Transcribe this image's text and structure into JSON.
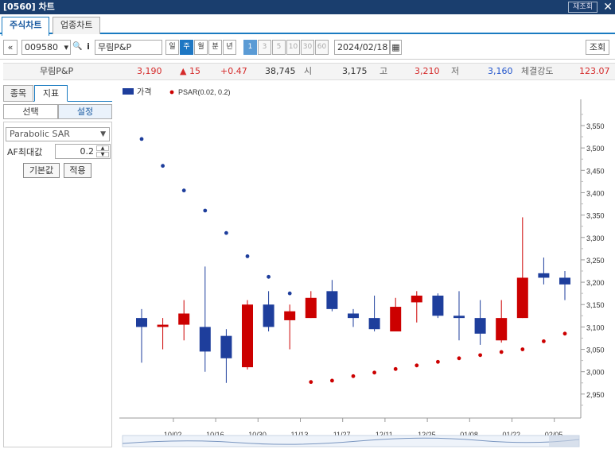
{
  "window": {
    "title": "[0560] 차트",
    "refresh": "재조회",
    "close": "✕"
  },
  "tabs": [
    {
      "label": "주식차트"
    },
    {
      "label": "업종차트"
    }
  ],
  "toolbar": {
    "nav": "«",
    "code": "009580",
    "dropdown": "▾",
    "search": "🔍",
    "info": "i",
    "name": "무림P&P",
    "periods": [
      "일",
      "주",
      "월",
      "분",
      "년"
    ],
    "nums": [
      "1",
      "3",
      "5",
      "10",
      "30",
      "60"
    ],
    "date": "2024/02/18",
    "calendar": "▦",
    "query": "조회"
  },
  "quote": {
    "name": "무림P&P",
    "price": "3,190",
    "change": "▲ 15",
    "rate": "+0.47",
    "volume": "38,745",
    "open_l": "시",
    "open": "3,175",
    "high_l": "고",
    "high": "3,210",
    "low_l": "저",
    "low": "3,160",
    "str_l": "체결강도",
    "str": "123.07"
  },
  "left": {
    "tab1": "종목",
    "tab2": "지표",
    "sub1": "선택",
    "sub2": "설정",
    "indicator": "Parabolic SAR",
    "af_label": "AF최대값",
    "af_value": "0.2",
    "btn_default": "기본값",
    "btn_apply": "적용"
  },
  "colors": {
    "up": "#cc0000",
    "down": "#1e3e9c",
    "accent": "#1a7bc1"
  },
  "chart_data": {
    "type": "candlestick",
    "legend": [
      {
        "name": "가격"
      },
      {
        "name": "PSAR(0.02, 0.2)"
      }
    ],
    "ylim": [
      2900,
      3600
    ],
    "yticks": [
      "3,550",
      "3,500",
      "3,450",
      "3,400",
      "3,350",
      "3,300",
      "3,250",
      "3,200",
      "3,150",
      "3,100",
      "3,050",
      "3,000",
      "2,950"
    ],
    "ytickvals": [
      3550,
      3500,
      3450,
      3400,
      3350,
      3300,
      3250,
      3200,
      3150,
      3100,
      3050,
      3000,
      2950
    ],
    "xticks": [
      "10/02",
      "10/16",
      "10/30",
      "11/13",
      "11/27",
      "12/11",
      "12/25",
      "01/08",
      "01/22",
      "02/05"
    ],
    "xtickidx": [
      1.5,
      3.5,
      5.5,
      7.5,
      9.5,
      11.5,
      13.5,
      15.5,
      17.5,
      19.5
    ],
    "candles": [
      {
        "o": 3120,
        "h": 3140,
        "l": 3020,
        "c": 3100
      },
      {
        "o": 3100,
        "h": 3120,
        "l": 3050,
        "c": 3105
      },
      {
        "o": 3105,
        "h": 3160,
        "l": 3070,
        "c": 3130
      },
      {
        "o": 3100,
        "h": 3235,
        "l": 3000,
        "c": 3045
      },
      {
        "o": 3080,
        "h": 3095,
        "l": 2975,
        "c": 3030
      },
      {
        "o": 3010,
        "h": 3160,
        "l": 3005,
        "c": 3150
      },
      {
        "o": 3150,
        "h": 3180,
        "l": 3090,
        "c": 3100
      },
      {
        "o": 3115,
        "h": 3150,
        "l": 3050,
        "c": 3135
      },
      {
        "o": 3120,
        "h": 3180,
        "l": 3120,
        "c": 3165
      },
      {
        "o": 3180,
        "h": 3205,
        "l": 3135,
        "c": 3140
      },
      {
        "o": 3130,
        "h": 3140,
        "l": 3100,
        "c": 3120
      },
      {
        "o": 3120,
        "h": 3170,
        "l": 3090,
        "c": 3095
      },
      {
        "o": 3090,
        "h": 3165,
        "l": 3090,
        "c": 3145
      },
      {
        "o": 3155,
        "h": 3180,
        "l": 3110,
        "c": 3170
      },
      {
        "o": 3170,
        "h": 3175,
        "l": 3120,
        "c": 3125
      },
      {
        "o": 3125,
        "h": 3180,
        "l": 3070,
        "c": 3120
      },
      {
        "o": 3120,
        "h": 3160,
        "l": 3060,
        "c": 3085
      },
      {
        "o": 3070,
        "h": 3160,
        "l": 3065,
        "c": 3120
      },
      {
        "o": 3120,
        "h": 3345,
        "l": 3120,
        "c": 3210
      },
      {
        "o": 3220,
        "h": 3255,
        "l": 3195,
        "c": 3210
      },
      {
        "o": 3210,
        "h": 3225,
        "l": 3160,
        "c": 3195
      }
    ],
    "psar": [
      {
        "i": 0,
        "v": 3520,
        "up": false
      },
      {
        "i": 1,
        "v": 3460,
        "up": false
      },
      {
        "i": 2,
        "v": 3405,
        "up": false
      },
      {
        "i": 3,
        "v": 3360,
        "up": false
      },
      {
        "i": 4,
        "v": 3310,
        "up": false
      },
      {
        "i": 5,
        "v": 3258,
        "up": false
      },
      {
        "i": 6,
        "v": 3212,
        "up": false
      },
      {
        "i": 7,
        "v": 3175,
        "up": false
      },
      {
        "i": 8,
        "v": 2977,
        "up": true
      },
      {
        "i": 9,
        "v": 2980,
        "up": true
      },
      {
        "i": 10,
        "v": 2990,
        "up": true
      },
      {
        "i": 11,
        "v": 2998,
        "up": true
      },
      {
        "i": 12,
        "v": 3006,
        "up": true
      },
      {
        "i": 13,
        "v": 3014,
        "up": true
      },
      {
        "i": 14,
        "v": 3022,
        "up": true
      },
      {
        "i": 15,
        "v": 3030,
        "up": true
      },
      {
        "i": 16,
        "v": 3037,
        "up": true
      },
      {
        "i": 17,
        "v": 3044,
        "up": true
      },
      {
        "i": 18,
        "v": 3050,
        "up": true
      },
      {
        "i": 19,
        "v": 3068,
        "up": true
      },
      {
        "i": 20,
        "v": 3085,
        "up": true
      }
    ]
  }
}
